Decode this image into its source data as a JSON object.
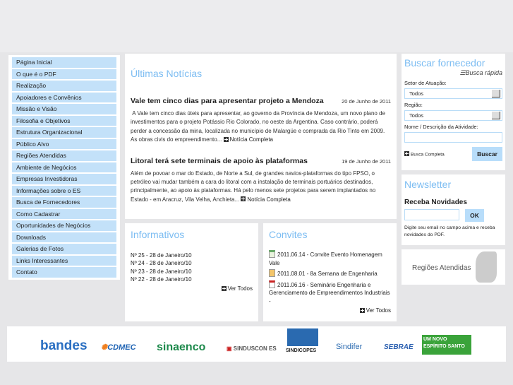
{
  "sidebar": {
    "items": [
      "Página Inicial",
      "O que é o PDF",
      "Realização",
      "Apoiadores e Convênios",
      "Missão e Visão",
      "Filosofia e Objetivos",
      "Estrutura Organizacional",
      "Público Alvo",
      "Regiões Atendidas",
      "Ambiente de Negócios",
      "Empresas Investidoras",
      "Informações sobre o ES",
      "Busca de Fornecedores",
      "Como Cadastrar",
      "Oportunidades de Negócios",
      "Downloads",
      "Galerias de Fotos",
      "Links Interessantes",
      "Contato"
    ]
  },
  "news": {
    "title": "Últimas Notícias",
    "items": [
      {
        "title": "Vale tem cinco dias para apresentar projeto a Mendoza",
        "date": "20 de Junho de 2011",
        "body": "A Vale tem cinco dias úteis para apresentar, ao governo da Província de Mendoza, um novo plano de investimentos para o projeto Potássio Rio Colorado, no oeste da Argentina. Caso contrário, poderá perder a concessão da mina, localizada no município de Malargüe e comprada da Rio Tinto em 2009. As obras civis do empreendimento...",
        "more": "Notícia Completa"
      },
      {
        "title": "Litoral terá sete terminais de apoio às plataformas",
        "date": "19 de Junho de 2011",
        "body": "Além de povoar o mar do Estado, de Norte a Sul, de grandes navios-plataformas do tipo FPSO, o petróleo vai mudar também a cara do litoral com a instalação de terminais portuários destinados, principalmente, ao apoio às plataformas. Há pelo menos sete projetos para serem implantados no Estado - em Aracruz, Vila Velha, Anchieta...",
        "more": "Notícia Completa"
      }
    ]
  },
  "informativos": {
    "title": "Informativos",
    "items": [
      "Nº 25 - 28 de Janeiro/10",
      "Nº 24 - 28 de Janeiro/10",
      "Nº 23 - 28 de Janeiro/10",
      "Nº 22 - 28 de Janeiro/10"
    ],
    "more": "Ver Todos"
  },
  "convites": {
    "title": "Convites",
    "items": [
      "2011.06.14 - Convite Evento Homenagem Vale",
      "2011.08.01 - 8a Semana de Engenharia",
      "2011.06.16 - Seminário Engenharia e Gerenciamento de Empreendimentos Industriais -"
    ],
    "more": "Ver Todos"
  },
  "busca": {
    "title": "Buscar fornecedor",
    "subtitle": "Busca rápida",
    "setor_label": "Setor de Atuação:",
    "setor_value": "Todos",
    "regiao_label": "Região:",
    "regiao_value": "Todos",
    "nome_label": "Nome / Descrição da Atividade:",
    "nome_value": "",
    "completa": "Busca Completa",
    "button": "Buscar"
  },
  "newsletter": {
    "title": "Newsletter",
    "heading": "Receba Novidades",
    "email_value": "",
    "button": "OK",
    "hint": "Digite seu email no campo acima e receba novidades do PDF."
  },
  "regioes": {
    "label": "Regiões Atendidas"
  },
  "footer": {
    "logos": [
      "bandes",
      "CDMEC",
      "sinaenco",
      "SINDUSCON ES",
      "SINDICOPES",
      "Sindifer",
      "SEBRAE",
      "UM NOVO ESPÍRITO SANTO"
    ]
  }
}
